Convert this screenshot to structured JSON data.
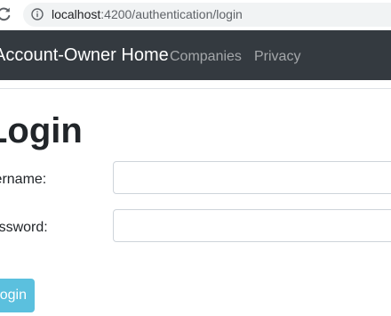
{
  "browser": {
    "url_host": "localhost",
    "url_path": ":4200/authentication/login",
    "reload_icon": "reload-icon",
    "info_icon": "info-icon"
  },
  "navbar": {
    "brand": "Account-Owner Home",
    "links": [
      {
        "label": "Companies"
      },
      {
        "label": "Privacy"
      }
    ],
    "background": "#343a40"
  },
  "login": {
    "title": "Login",
    "username_label": "Username:",
    "username_value": "",
    "password_label": "Password:",
    "password_value": "",
    "submit_label": "Login",
    "button_color": "#5bc0de"
  }
}
